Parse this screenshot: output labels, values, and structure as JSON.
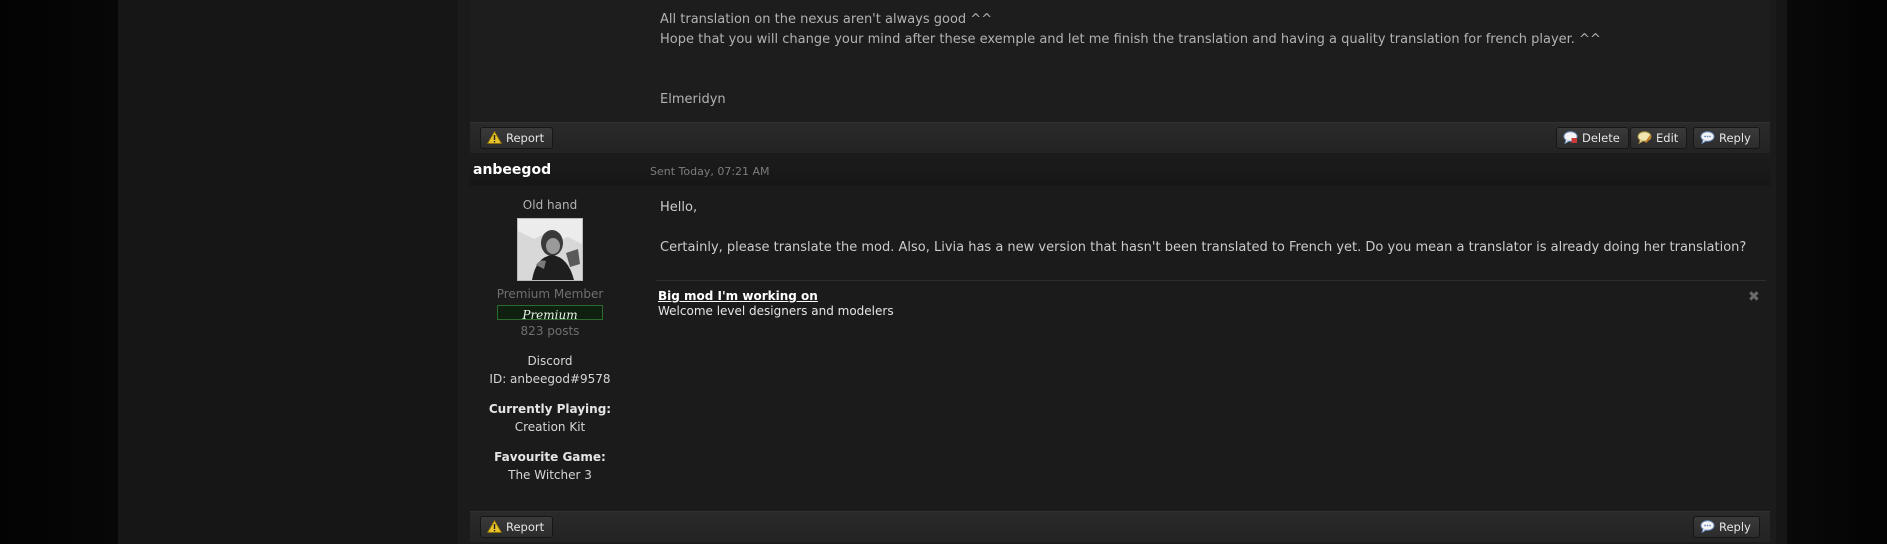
{
  "post1": {
    "lines": [
      "All translation on the nexus aren't always good ^^",
      "Hope that you will change your mind after these exemple and let me finish the translation and having a quality translation for french player. ^^"
    ],
    "signoff": "Elmeridyn",
    "actions": {
      "report": "Report",
      "delete": "Delete",
      "edit": "Edit",
      "reply": "Reply"
    }
  },
  "post2": {
    "author": "anbeegod",
    "sent": "Sent Today, 07:21 AM",
    "user": {
      "rank": "Old hand",
      "member_group": "Premium Member",
      "premium_badge": "Premium",
      "posts": "823 posts",
      "discord_label": "Discord",
      "discord_id": "ID: anbeegod#9578",
      "playing_label": "Currently Playing:",
      "playing_value": "Creation Kit",
      "favourite_label": "Favourite Game:",
      "favourite_value": "The Witcher 3"
    },
    "body": {
      "greeting": "Hello,",
      "text": "Certainly, please translate the mod. Also, Livia has a new version that hasn't been translated to French yet. Do you mean a translator is already doing her translation?"
    },
    "signature": {
      "link": "Big mod I'm working on",
      "text": "Welcome level designers and modelers"
    },
    "actions": {
      "report": "Report",
      "reply": "Reply"
    }
  },
  "icons": [
    "warning-icon",
    "speech-bubble-icon",
    "edit-icon",
    "close-icon"
  ]
}
